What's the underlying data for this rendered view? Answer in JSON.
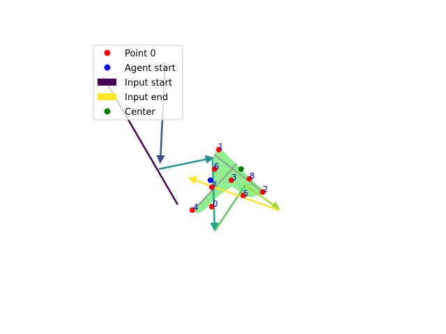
{
  "legend": {
    "items": [
      {
        "label": "Point 0",
        "kind": "dot",
        "color": "#ff0000"
      },
      {
        "label": "Agent start",
        "kind": "dot",
        "color": "#0000ff"
      },
      {
        "label": "Input start",
        "kind": "bar",
        "color": "#440154"
      },
      {
        "label": "Input end",
        "kind": "bar",
        "color": "#fde725"
      },
      {
        "label": "Center",
        "kind": "dot",
        "color": "#008000"
      }
    ]
  },
  "point_labels": [
    "0",
    "1",
    "2",
    "3",
    "4",
    "5",
    "6",
    "7",
    "8"
  ],
  "colors": {
    "shape_fill": "#90ee90",
    "point": "#ff0000",
    "agent": "#0000ff",
    "center": "#008000",
    "label": "#0000cc",
    "gradient": [
      "#440154",
      "#3b528b",
      "#21918c",
      "#5ec962",
      "#fde725"
    ]
  }
}
